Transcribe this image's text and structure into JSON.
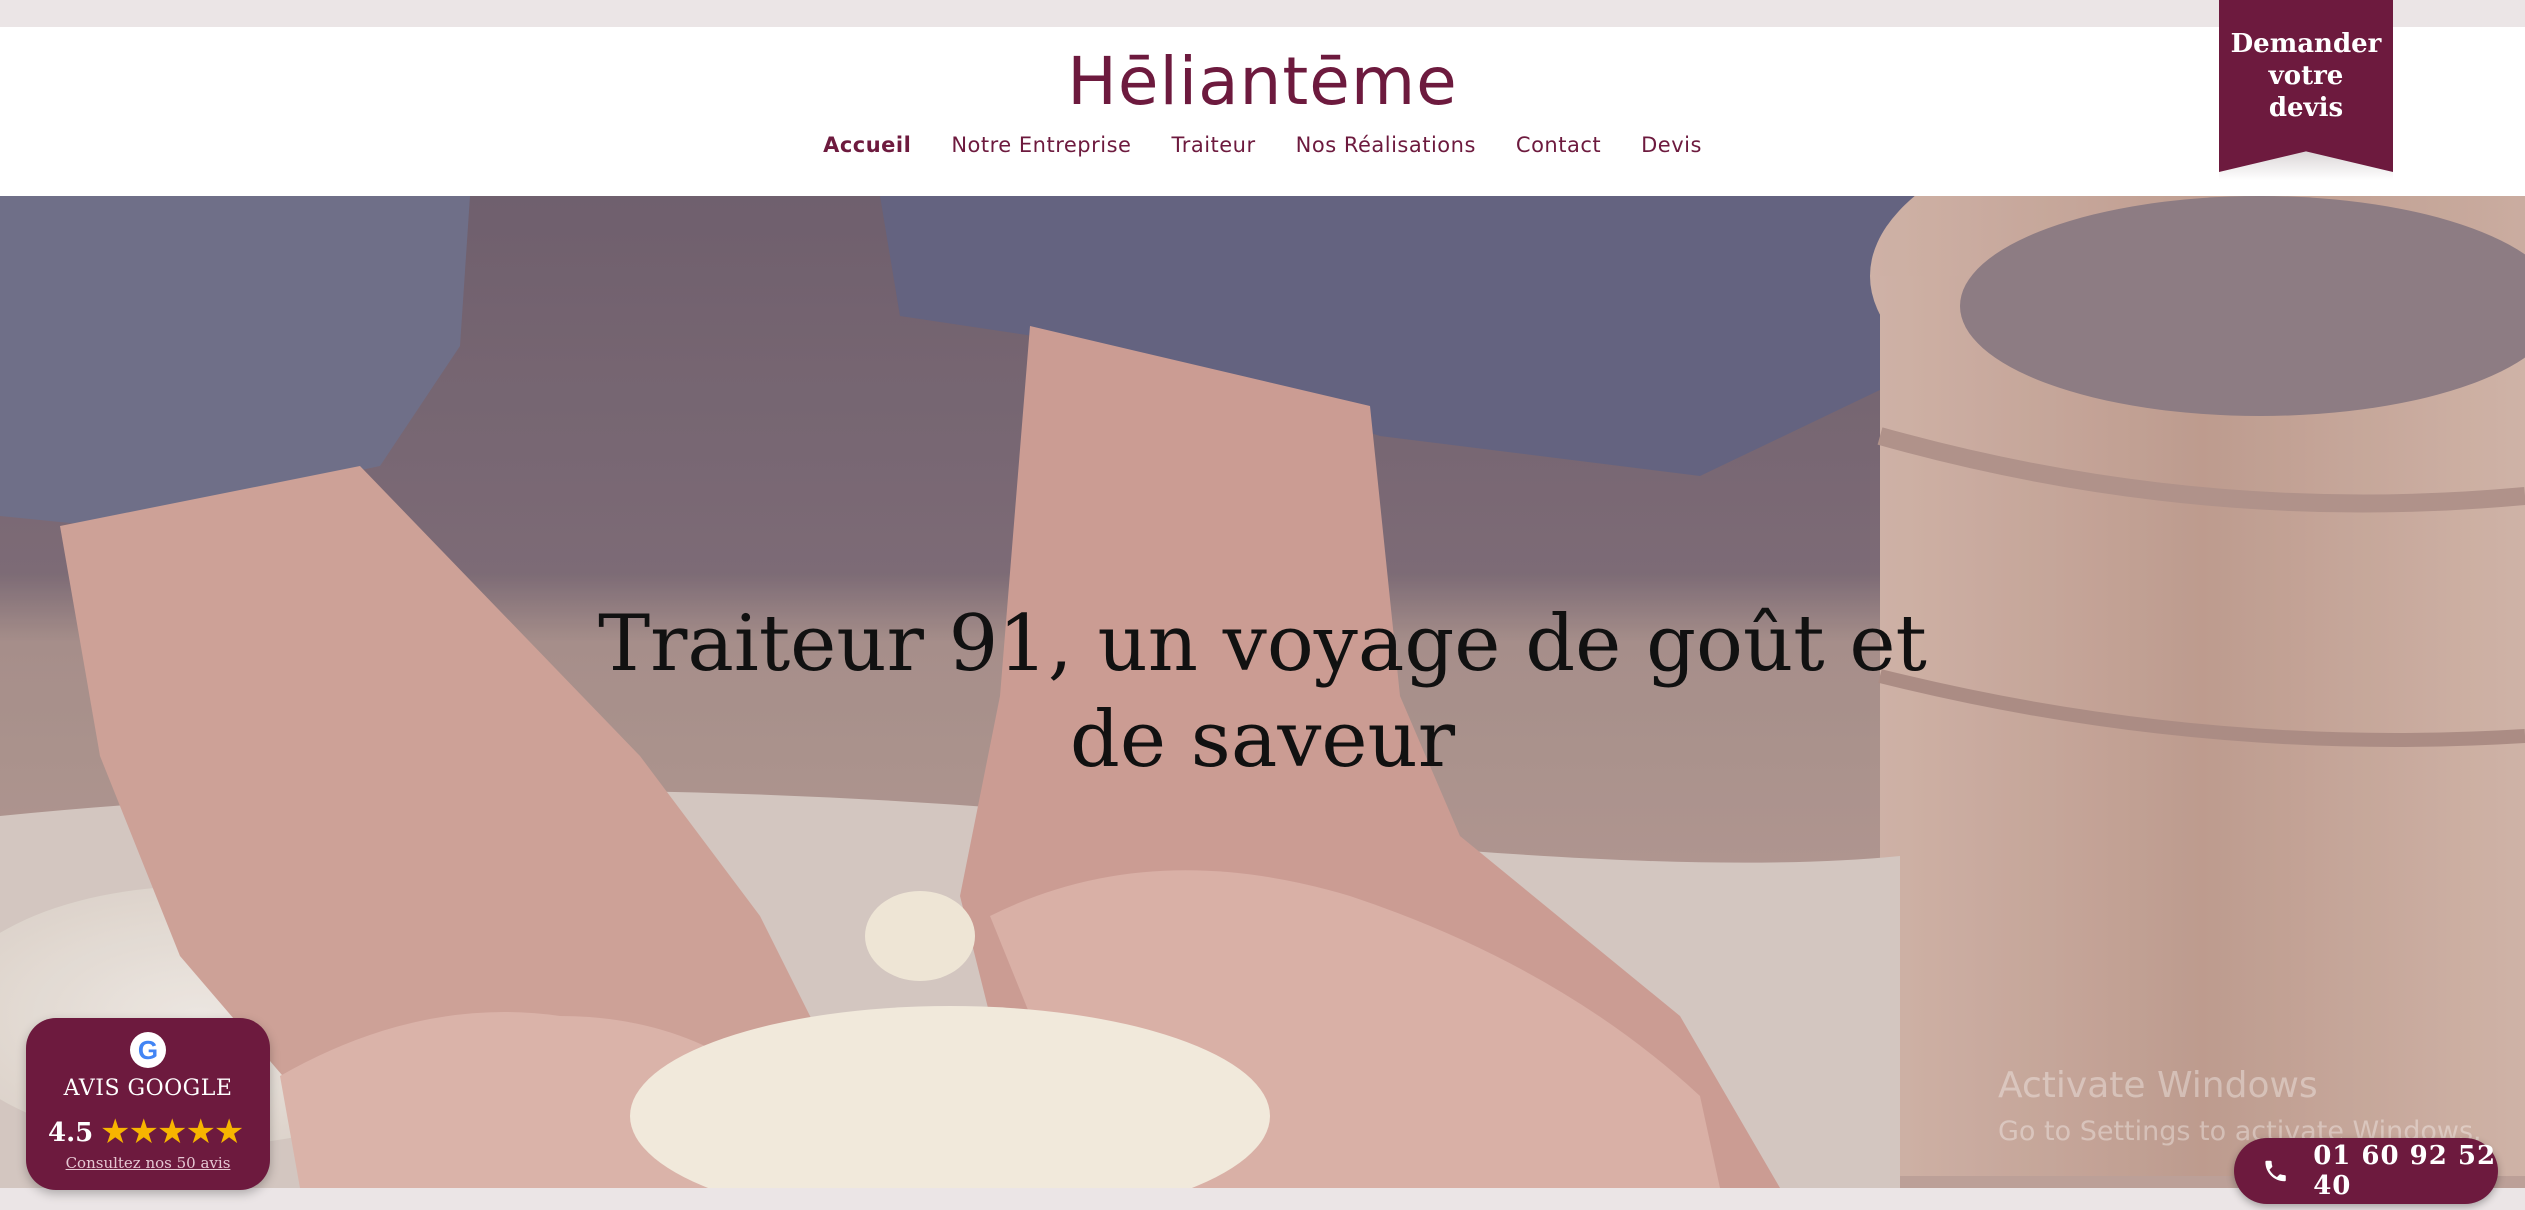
{
  "header": {
    "logo_text": "Hēliantēme",
    "nav": [
      {
        "label": "Accueil",
        "active": true
      },
      {
        "label": "Notre Entreprise",
        "active": false
      },
      {
        "label": "Traiteur",
        "active": false
      },
      {
        "label": "Nos Réalisations",
        "active": false
      },
      {
        "label": "Contact",
        "active": false
      },
      {
        "label": "Devis",
        "active": false
      }
    ],
    "devis_ribbon": {
      "line1": "Demander",
      "line2": "votre",
      "line3": "devis"
    }
  },
  "hero": {
    "title_line1": "Traiteur 91, un voyage de goût et",
    "title_line2": "de saveur",
    "image_description_icon": "baker-kneading-dough-photo"
  },
  "google_widget": {
    "logo_letter": "G",
    "title": "AVIS GOOGLE",
    "rating": "4.5",
    "stars": "★★★★★",
    "link_text": "Consultez nos 50 avis"
  },
  "windows_watermark": {
    "line1": "Activate Windows",
    "line2": "Go to Settings to activate Windows."
  },
  "phone": {
    "icon": "phone-icon",
    "number": "01 60 92 52 40"
  },
  "colors": {
    "brand": "#6d1a3e",
    "background_strip": "#ebe5e6",
    "star": "#f7b500"
  }
}
